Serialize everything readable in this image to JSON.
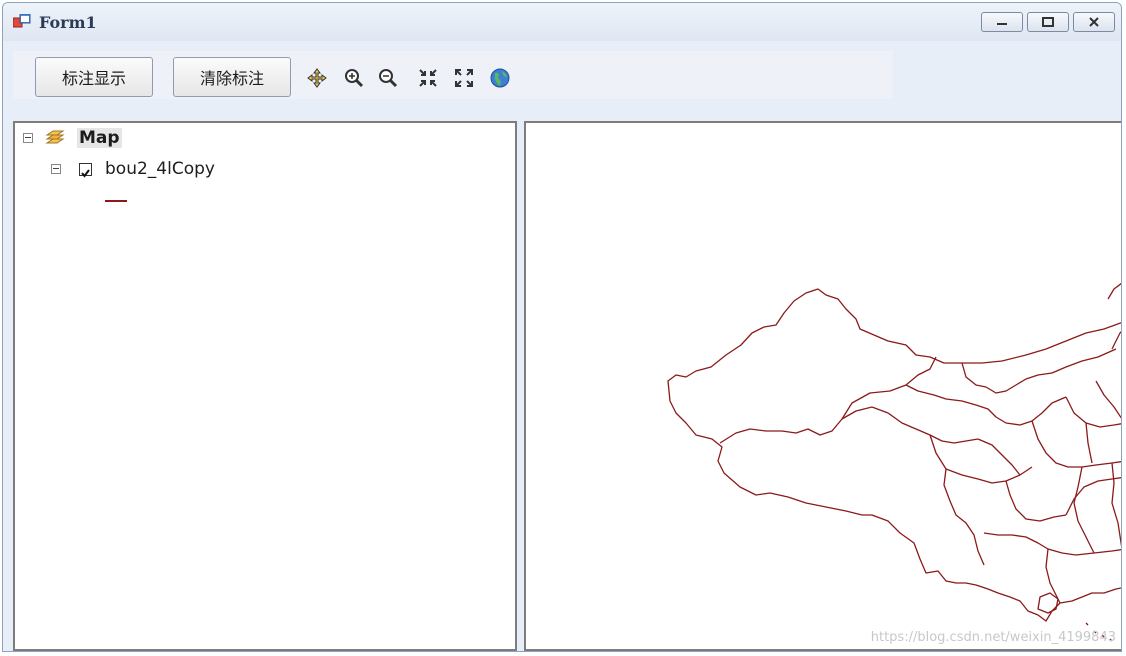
{
  "window": {
    "title": "Form1",
    "controls": {
      "minimize_icon": "minimize-icon",
      "maximize_icon": "maximize-icon",
      "close_icon": "close-icon"
    }
  },
  "toolbar": {
    "label_display_button": "标注显示",
    "clear_label_button": "清除标注",
    "tools": [
      "pan-icon",
      "zoom-in-icon",
      "zoom-out-icon",
      "fixed-zoom-in-icon",
      "full-extent-icon",
      "globe-icon"
    ]
  },
  "toc": {
    "root_label": "Map",
    "layer_label": "bou2_4lCopy",
    "layer_checked": true,
    "symbol_color": "#8b1a1a"
  },
  "map": {
    "line_color": "#8b1a1a",
    "watermark": "https://blog.csdn.net/weixin_4199843"
  }
}
